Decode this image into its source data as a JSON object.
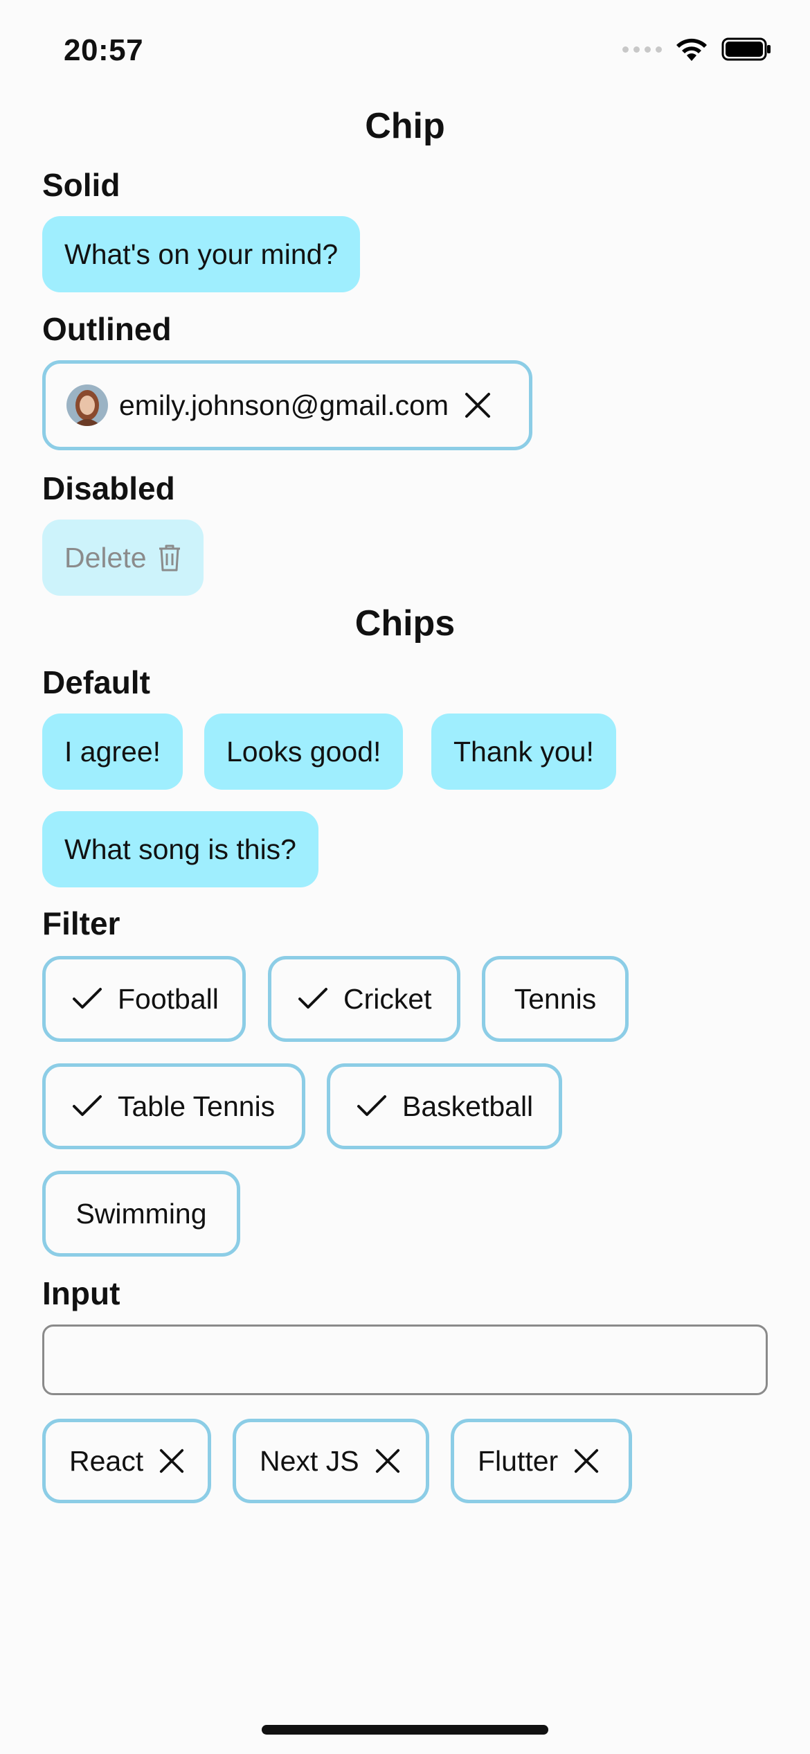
{
  "status_bar": {
    "time": "20:57"
  },
  "chip_section": {
    "title": "Chip",
    "solid": {
      "label": "Solid",
      "chip_text": "What's on your mind?"
    },
    "outlined": {
      "label": "Outlined",
      "chip_text": "emily.johnson@gmail.com",
      "icon": "close-icon"
    },
    "disabled": {
      "label": "Disabled",
      "chip_text": "Delete",
      "icon": "trash-icon"
    }
  },
  "chips_section": {
    "title": "Chips",
    "default": {
      "label": "Default",
      "items": [
        "I agree!",
        "Looks good!",
        "Thank you!",
        "What song is this?"
      ]
    },
    "filter": {
      "label": "Filter",
      "items": [
        {
          "text": "Football",
          "selected": true
        },
        {
          "text": "Cricket",
          "selected": true
        },
        {
          "text": "Tennis",
          "selected": false
        },
        {
          "text": "Table Tennis",
          "selected": true
        },
        {
          "text": "Basketball",
          "selected": true
        },
        {
          "text": "Swimming",
          "selected": false
        }
      ]
    },
    "input": {
      "label": "Input",
      "field_value": "",
      "placeholder": "",
      "tags": [
        "React",
        "Next JS",
        "Flutter"
      ]
    }
  },
  "colors": {
    "chip_solid_bg": "#9feefe",
    "chip_outline_border": "#8ccde6",
    "chip_disabled_bg": "#cdf3fb",
    "background": "#fbfbfb"
  }
}
